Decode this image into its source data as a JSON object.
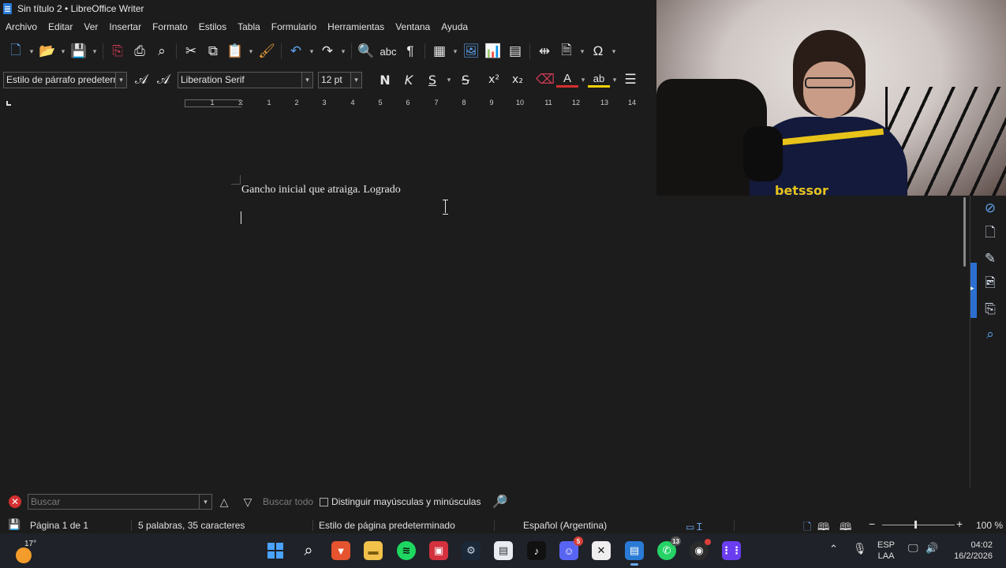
{
  "window": {
    "title": "Sin título 2 • LibreOffice Writer"
  },
  "menu": [
    "Archivo",
    "Editar",
    "Ver",
    "Insertar",
    "Formato",
    "Estilos",
    "Tabla",
    "Formulario",
    "Herramientas",
    "Ventana",
    "Ayuda"
  ],
  "formatting": {
    "paragraph_style": "Estilo de párrafo predetermi",
    "font_name": "Liberation Serif",
    "font_size": "12 pt",
    "bold": "N",
    "italic": "K",
    "underline": "S",
    "strike": "S",
    "superscript": "x²",
    "subscript": "x₂"
  },
  "ruler": {
    "numbers": [
      "1",
      "1",
      "2",
      "3",
      "4",
      "5",
      "6",
      "7",
      "8",
      "9",
      "10",
      "11",
      "12",
      "13",
      "14"
    ]
  },
  "document": {
    "text": "Gancho inicial que atraiga. Logrado"
  },
  "find": {
    "placeholder": "Buscar",
    "find_all": "Buscar todo",
    "match_case": "Distinguir mayúsculas y minúsculas"
  },
  "status": {
    "page": "Página 1 de 1",
    "words": "5 palabras, 35 caracteres",
    "page_style": "Estilo de página predeterminado",
    "language": "Español (Argentina)",
    "zoom": "100 %"
  },
  "taskbar": {
    "weather_temp": "17°",
    "discord_badge": "5",
    "whatsapp_badge": "13",
    "input_lang": "ESP",
    "input_layout": "LAA",
    "time": "04:02",
    "date": "16/2/2026"
  },
  "webcam": {
    "sponsor_text": "betssor"
  },
  "colors": {
    "accent": "#2c6fd1",
    "background": "#1c1c1c",
    "taskbar": "#1f2228"
  }
}
